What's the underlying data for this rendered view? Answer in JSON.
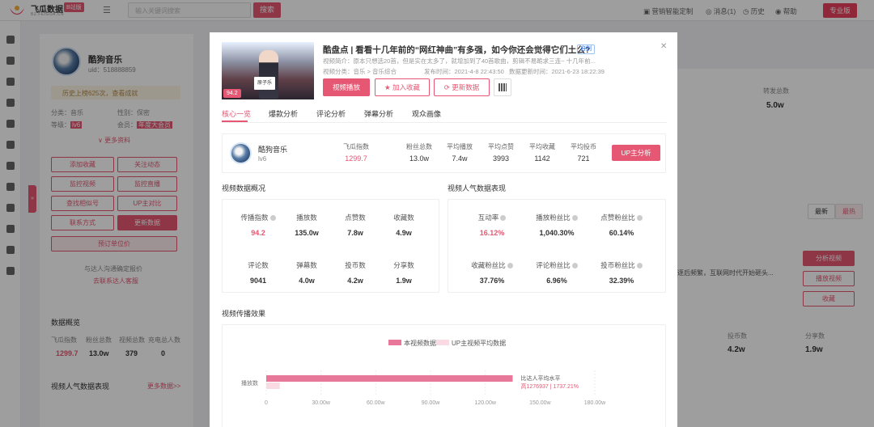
{
  "topbar": {
    "brand": "飞瓜数据",
    "brand_sub": "BZ.FEIGUA.CN",
    "brand_badge": "B站版",
    "search_placeholder": "输入关键词搜索",
    "search_button": "搜索",
    "links": [
      "营销智能定制",
      "消息(1)",
      "历史",
      "帮助"
    ],
    "vip_button": "专业版"
  },
  "profile": {
    "name": "酷狗音乐",
    "uid": "uid：518888859",
    "tip": "历史上榜625次，查看成就",
    "fields": [
      {
        "label": "分类：",
        "value": "音乐"
      },
      {
        "label": "性别：",
        "value": "保密"
      },
      {
        "label": "等级：",
        "value": "lv6"
      },
      {
        "label": "会员：",
        "value": "年度大会员"
      }
    ],
    "more": "更多资料",
    "buttons": [
      "添加收藏",
      "关注动态",
      "监控视频",
      "监控直播",
      "查找相似号",
      "UP主对比",
      "联系方式",
      "更新数据"
    ],
    "subscribe": "预订单位价",
    "compare_text": "与达人沟通确定报价",
    "compare_link": "去联系达人客服",
    "overview_title": "数据概览",
    "overview_labels": [
      "飞瓜指数",
      "粉丝总数",
      "视频总数",
      "充电总人数"
    ],
    "overview_values": [
      "1299.7",
      "13.0w",
      "379",
      "0"
    ],
    "pop_title": "视频人气数据表现",
    "pop_link": "更多数据>>"
  },
  "background_right": {
    "label1": "转发总数",
    "value1": "5.0w",
    "toggle": [
      "最新",
      "最热"
    ],
    "desc": "逐后频繁，互联网时代开始砸头...",
    "btn_analysis": "分析视频",
    "btn_play": "播放视频",
    "btn_fav": "收藏",
    "col_labels": [
      "投币数",
      "分享数"
    ],
    "col_values": [
      "4.2w",
      "1.9w"
    ]
  },
  "modal": {
    "thumb_sign": "原子乐",
    "thumb_score": "94.2",
    "title": "酷盘点 | 看看十几年前的“网红神曲”有多强，如今你还会觉得它们土么?",
    "own_tag": "自制",
    "intro": "视频简介：原本只想选20首，但是实在太多了，就增加到了40首歌曲，剪辑不易跪求三连~ 十几年前...",
    "meta_category": "视频分类：音乐 > 音乐综合",
    "meta_published": "发布时间：2021-4-8 22:43:50",
    "meta_updated": "数据更新时间：2021-6-23 18:22:39",
    "buttons": {
      "play": "视频播放",
      "fav": "加入收藏",
      "update": "更新数据"
    },
    "tabs": [
      "核心一览",
      "爆款分析",
      "评论分析",
      "弹幕分析",
      "观众画像"
    ],
    "up": {
      "name": "酷狗音乐",
      "level": "lv6",
      "stats": [
        {
          "label": "飞瓜指数",
          "value": "1299.7"
        },
        {
          "label": "粉丝总数",
          "value": "13.0w"
        },
        {
          "label": "平均播放",
          "value": "7.4w"
        },
        {
          "label": "平均点赞",
          "value": "3993"
        },
        {
          "label": "平均收藏",
          "value": "1142"
        },
        {
          "label": "平均投币",
          "value": "721"
        }
      ],
      "analyze_button": "UP主分析"
    },
    "overview": {
      "title": "视频数据概况",
      "metrics": [
        {
          "label": "传播指数",
          "value": "94.2"
        },
        {
          "label": "播放数",
          "value": "135.0w"
        },
        {
          "label": "点赞数",
          "value": "7.8w"
        },
        {
          "label": "收藏数",
          "value": "4.9w"
        },
        {
          "label": "评论数",
          "value": "9041"
        },
        {
          "label": "弹幕数",
          "value": "4.0w"
        },
        {
          "label": "投币数",
          "value": "4.2w"
        },
        {
          "label": "分享数",
          "value": "1.9w"
        }
      ]
    },
    "popularity": {
      "title": "视频人气数据表现",
      "metrics": [
        {
          "label": "互动率",
          "value": "16.12%"
        },
        {
          "label": "播放粉丝比",
          "value": "1,040.30%"
        },
        {
          "label": "点赞粉丝比",
          "value": "60.14%"
        },
        {
          "label": "收藏粉丝比",
          "value": "37.76%"
        },
        {
          "label": "评论粉丝比",
          "value": "6.96%"
        },
        {
          "label": "投币粉丝比",
          "value": "32.39%"
        }
      ]
    },
    "spread": {
      "title": "视频传播效果"
    }
  },
  "chart_data": {
    "type": "bar",
    "categories": [
      "播放数"
    ],
    "series": [
      {
        "name": "本视频数据",
        "values": [
          135.0
        ],
        "color": "#e8789a"
      },
      {
        "name": "UP主视频平均数据",
        "values": [
          7.4
        ],
        "color": "#fadbe3"
      }
    ],
    "xticks": [
      "0",
      "30.00w",
      "60.00w",
      "90.00w",
      "120.00w",
      "150.00w",
      "180.00w"
    ],
    "xlim": [
      0,
      180
    ],
    "annotation": "比达人平均水平",
    "annotation_sub": "高1276937 | 1737.21%",
    "legend": "top-center"
  }
}
